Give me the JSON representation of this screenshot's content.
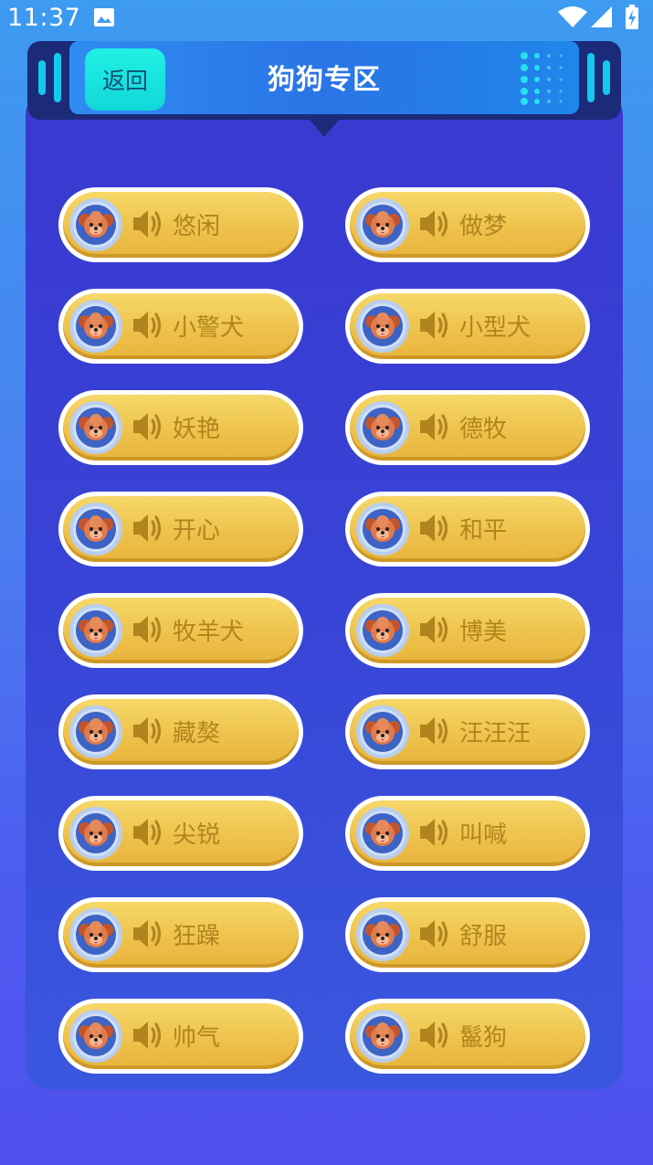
{
  "status_bar": {
    "time": "11:37"
  },
  "header": {
    "back_label": "返回",
    "title": "狗狗专区"
  },
  "sounds": [
    {
      "label": "悠闲"
    },
    {
      "label": "做梦"
    },
    {
      "label": "小警犬"
    },
    {
      "label": "小型犬"
    },
    {
      "label": "妖艳"
    },
    {
      "label": "德牧"
    },
    {
      "label": "开心"
    },
    {
      "label": "和平"
    },
    {
      "label": "牧羊犬"
    },
    {
      "label": "博美"
    },
    {
      "label": "藏獒"
    },
    {
      "label": "汪汪汪"
    },
    {
      "label": "尖锐"
    },
    {
      "label": "叫喊"
    },
    {
      "label": "狂躁"
    },
    {
      "label": "舒服"
    },
    {
      "label": "帅气"
    },
    {
      "label": "鬣狗"
    }
  ],
  "colors": {
    "button_fill": "#eec24d",
    "label_text": "#b0851e",
    "back_button": "#20f0e4",
    "panel": "#3744d6"
  },
  "icons": {
    "button_icon": "speaker-icon",
    "avatar": "dog-avatar"
  }
}
